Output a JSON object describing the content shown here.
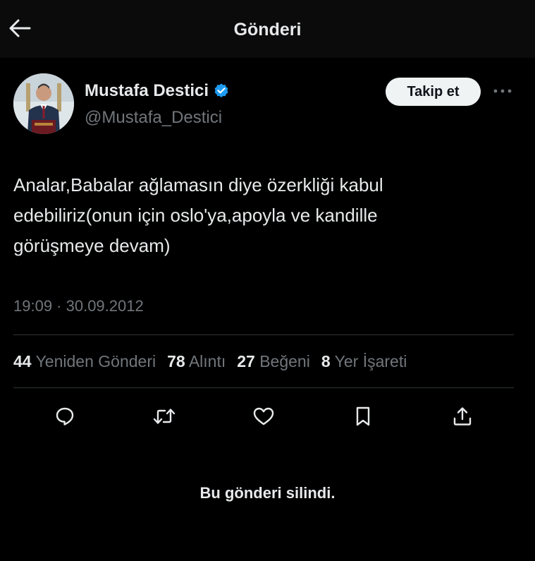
{
  "header": {
    "title": "Gönderi",
    "back_icon": "arrow-left-icon"
  },
  "author": {
    "display_name": "Mustafa Destici",
    "handle": "@Mustafa_Destici",
    "verified": true,
    "verified_color": "#1d9bf0"
  },
  "follow_button": {
    "label": "Takip et"
  },
  "tweet": {
    "lines": [
      "Analar,Babalar ağlamasın diye özerkliği kabul",
      "edebiliriz(onun için oslo'ya,apoyla ve kandille",
      "görüşmeye devam)"
    ],
    "timestamp": "19:09 · 30.09.2012"
  },
  "stats": [
    {
      "count": "44",
      "label": "Yeniden Gönderi"
    },
    {
      "count": "78",
      "label": "Alıntı"
    },
    {
      "count": "27",
      "label": "Beğeni"
    },
    {
      "count": "8",
      "label": "Yer İşareti"
    }
  ],
  "actions": [
    "reply-icon",
    "repost-icon",
    "like-icon",
    "bookmark-icon",
    "share-icon"
  ],
  "status_message": "Bu gönderi silindi.",
  "colors": {
    "background": "#000000",
    "text": "#e7e9ea",
    "muted": "#71767b",
    "divider": "#2f3336"
  }
}
